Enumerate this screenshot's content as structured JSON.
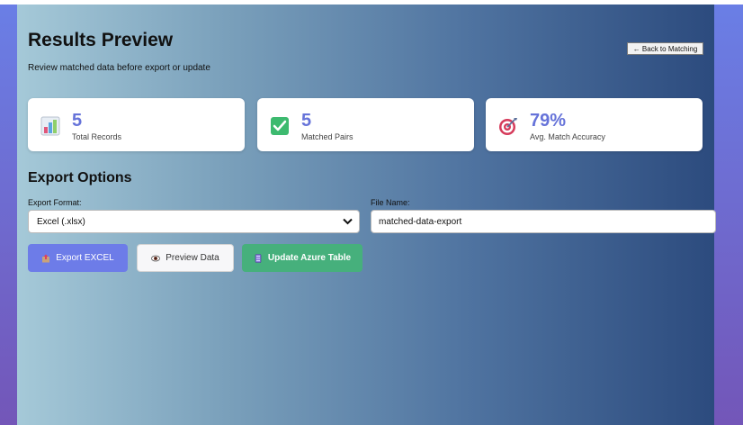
{
  "header": {
    "title": "Results Preview",
    "subtitle": "Review matched data before export or update",
    "back_label": "← Back to Matching"
  },
  "stats": [
    {
      "icon": "bar-chart-icon",
      "value": "5",
      "label": "Total Records"
    },
    {
      "icon": "check-icon",
      "value": "5",
      "label": "Matched Pairs"
    },
    {
      "icon": "target-icon",
      "value": "79%",
      "label": "Avg. Match Accuracy"
    }
  ],
  "export": {
    "section_title": "Export Options",
    "format_label": "Export Format:",
    "format_value": "Excel (.xlsx)",
    "filename_label": "File Name:",
    "filename_value": "matched-data-export"
  },
  "actions": {
    "export_label": "Export EXCEL",
    "preview_label": "Preview Data",
    "azure_label": "Update Azure Table"
  },
  "colors": {
    "accent": "#6d7ce8",
    "success": "#46b07c",
    "stat_value": "#6673d9"
  }
}
